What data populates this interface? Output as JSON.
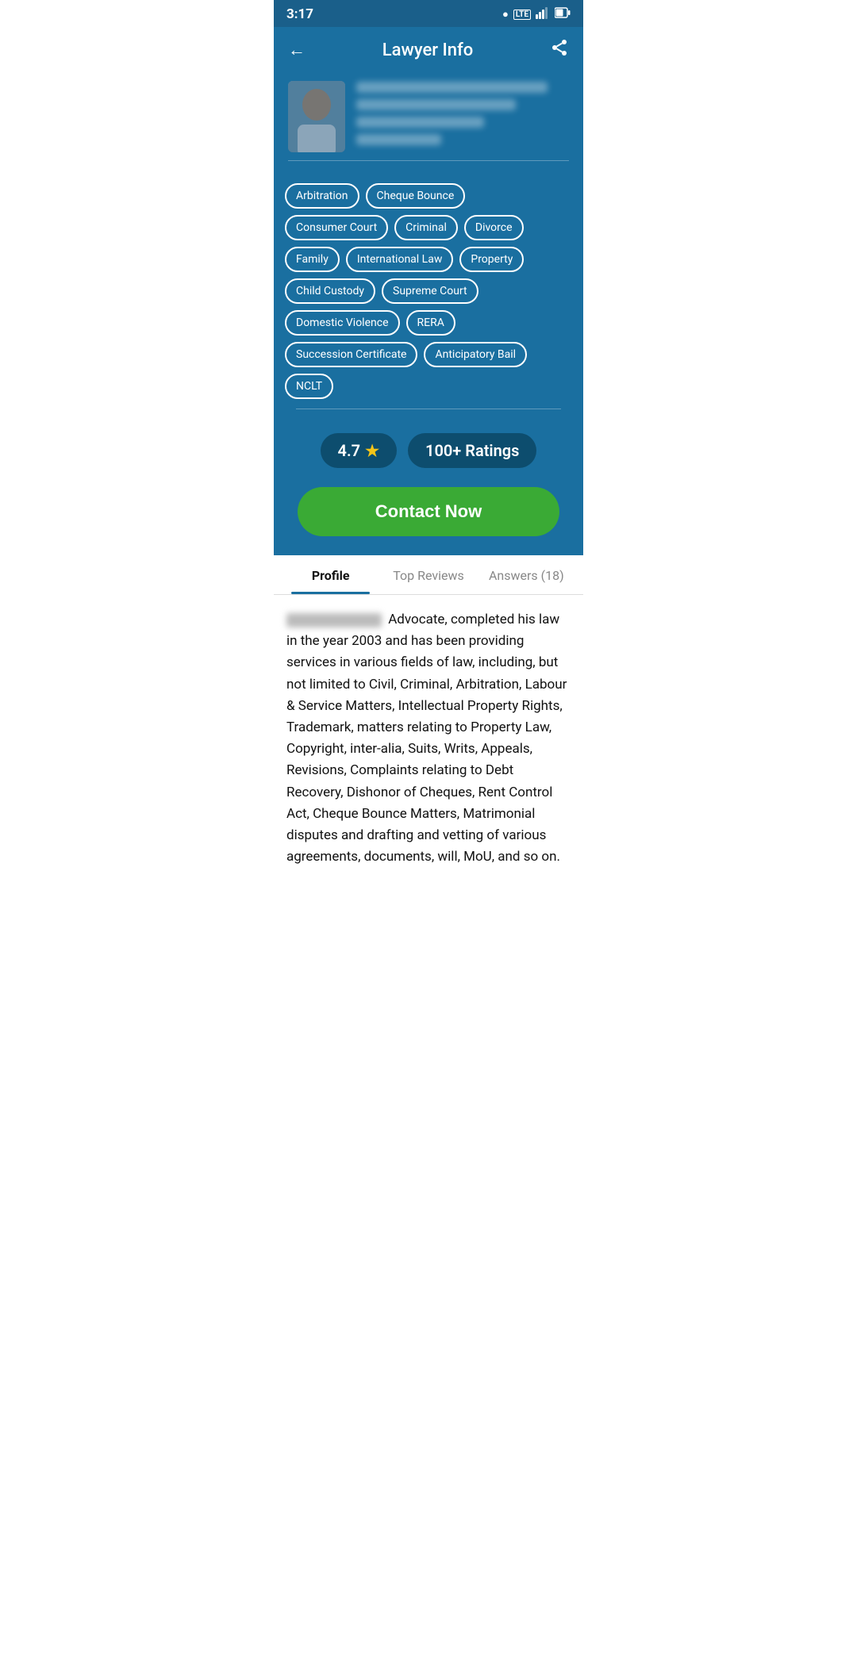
{
  "statusBar": {
    "time": "3:17",
    "lte": "LTE",
    "signalIcon": "▲",
    "batteryIcon": "🔋"
  },
  "header": {
    "backLabel": "←",
    "title": "Lawyer Info",
    "shareIcon": "share"
  },
  "profile": {
    "avatarAlt": "Lawyer photo",
    "blurredName": "Blurred Name",
    "blurredDetail1": "blurred detail",
    "blurredDetail2": "blurred short"
  },
  "tags": [
    "Arbitration",
    "Cheque Bounce",
    "Consumer Court",
    "Criminal",
    "Divorce",
    "Family",
    "International Law",
    "Property",
    "Child Custody",
    "Supreme Court",
    "Domestic Violence",
    "RERA",
    "Succession Certificate",
    "Anticipatory Bail",
    "NCLT"
  ],
  "rating": {
    "score": "4.7",
    "starIcon": "★",
    "ratingsLabel": "100+ Ratings"
  },
  "contactBtn": "Contact Now",
  "tabs": [
    {
      "id": "profile",
      "label": "Profile",
      "active": true
    },
    {
      "id": "top-reviews",
      "label": "Top Reviews",
      "active": false
    },
    {
      "id": "answers",
      "label": "Answers (18)",
      "active": false
    }
  ],
  "bio": {
    "blurredPart": "Blurred Name Here",
    "text": "Advocate, completed his law in the year 2003 and has been providing services in various fields of law, including, but not limited to Civil, Criminal, Arbitration, Labour & Service Matters, Intellectual Property Rights, Trademark, matters relating to Property Law, Copyright, inter-alia, Suits, Writs, Appeals, Revisions, Complaints relating to Debt Recovery, Dishonor of Cheques, Rent Control Act, Cheque Bounce Matters, Matrimonial disputes and drafting and vetting of various agreements, documents, will, MoU, and so on."
  }
}
